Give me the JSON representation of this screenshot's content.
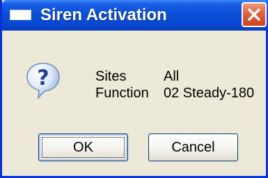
{
  "window": {
    "title": "Siren Activation"
  },
  "info": {
    "sites_label": "Sites",
    "sites_value": "All",
    "function_label": "Function",
    "function_value": "02 Steady-180"
  },
  "buttons": {
    "ok": "OK",
    "cancel": "Cancel"
  },
  "icons": {
    "title": "window-icon",
    "close": "close-icon",
    "dialog": "question-icon"
  },
  "colors": {
    "titlebar": "#0a4fd8",
    "close": "#e2603c",
    "face": "#ece9d8"
  }
}
